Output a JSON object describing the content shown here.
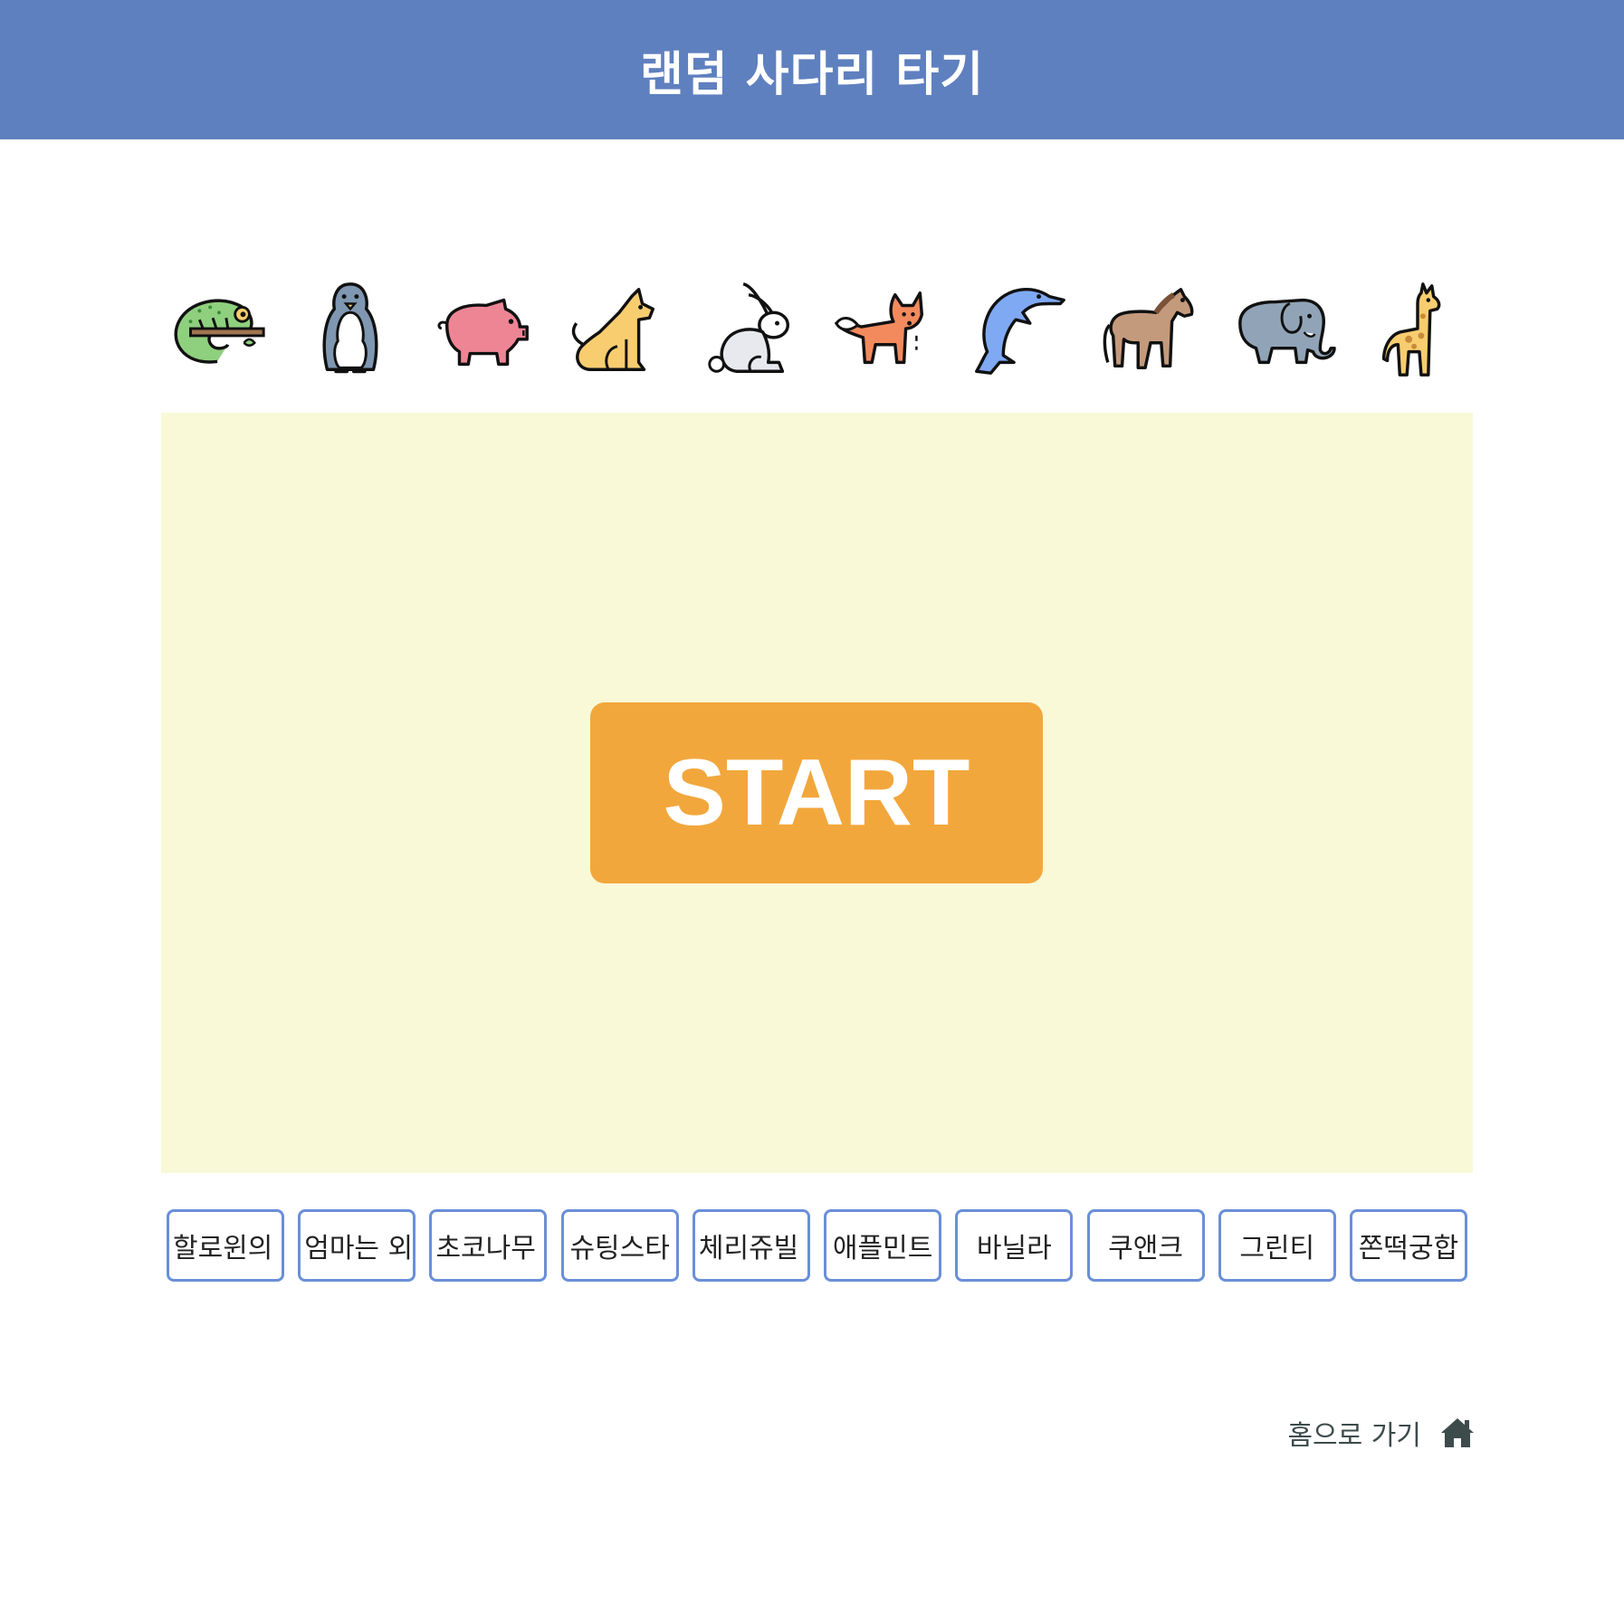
{
  "header": {
    "title": "랜덤 사다리 타기"
  },
  "animals": [
    {
      "name": "chameleon-icon",
      "color": "#8fd07e"
    },
    {
      "name": "penguin-icon",
      "color": "#7f97b0"
    },
    {
      "name": "pig-icon",
      "color": "#ee8595"
    },
    {
      "name": "dog-icon",
      "color": "#f7cd6f"
    },
    {
      "name": "rabbit-icon",
      "color": "#e7e9ee"
    },
    {
      "name": "fox-icon",
      "color": "#f28a5e"
    },
    {
      "name": "dolphin-icon",
      "color": "#7fa9f2"
    },
    {
      "name": "horse-icon",
      "color": "#c49a7c"
    },
    {
      "name": "elephant-icon",
      "color": "#91a4b7"
    },
    {
      "name": "giraffe-icon",
      "color": "#f7cd6f"
    }
  ],
  "board": {
    "background": "#f9f9d7",
    "start_label": "START"
  },
  "results": [
    "할로윈의",
    "엄마는 외",
    "초코나무",
    "슈팅스타",
    "체리쥬빌",
    "애플민트",
    "바닐라",
    "쿠앤크",
    "그린티",
    "쫀떡궁합"
  ],
  "footer": {
    "home_label": "홈으로 가기",
    "home_icon": "home-icon"
  },
  "colors": {
    "header": "#5f80bf",
    "start_button": "#f2a73c",
    "result_border": "#6a8fd8"
  }
}
